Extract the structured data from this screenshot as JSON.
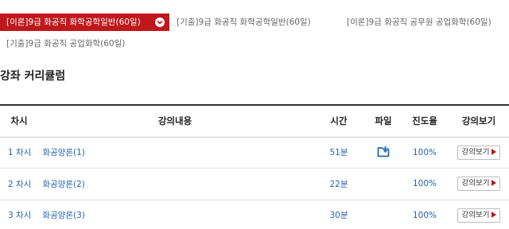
{
  "tabs": [
    {
      "label": "[이론]9급 화공직 화학공학일반(60일)",
      "active": true
    },
    {
      "label": "[기출]9급 화공직 화학공학일반(60일)",
      "active": false
    },
    {
      "label": "[이론]9급 화공직 공무원 공업화학(60일)",
      "active": false
    },
    {
      "label": "[기출]9급 화공직 공업화학(60일)",
      "active": false
    }
  ],
  "section_title": "강좌 커리큘럼",
  "table": {
    "headers": [
      "차시",
      "강의내용",
      "시간",
      "파일",
      "진도율",
      "강의보기"
    ],
    "rows": [
      {
        "num": "1 차시",
        "title": "화공양론(1)",
        "time": "51분",
        "has_file": true,
        "progress": "100%",
        "watch": "강의보기"
      },
      {
        "num": "2 차시",
        "title": "화공양론(2)",
        "time": "22분",
        "has_file": false,
        "progress": "100%",
        "watch": "강의보기"
      },
      {
        "num": "3 차시",
        "title": "화공양론(3)",
        "time": "30분",
        "has_file": false,
        "progress": "100%",
        "watch": "강의보기"
      }
    ]
  },
  "colors": {
    "accent": "#c0171c",
    "link": "#2563b0",
    "file_icon": "#1f6fb5"
  },
  "icons": {
    "tab_toggle": "chevron-down-icon",
    "file": "download-file-icon",
    "watch": "play-arrow-icon"
  }
}
